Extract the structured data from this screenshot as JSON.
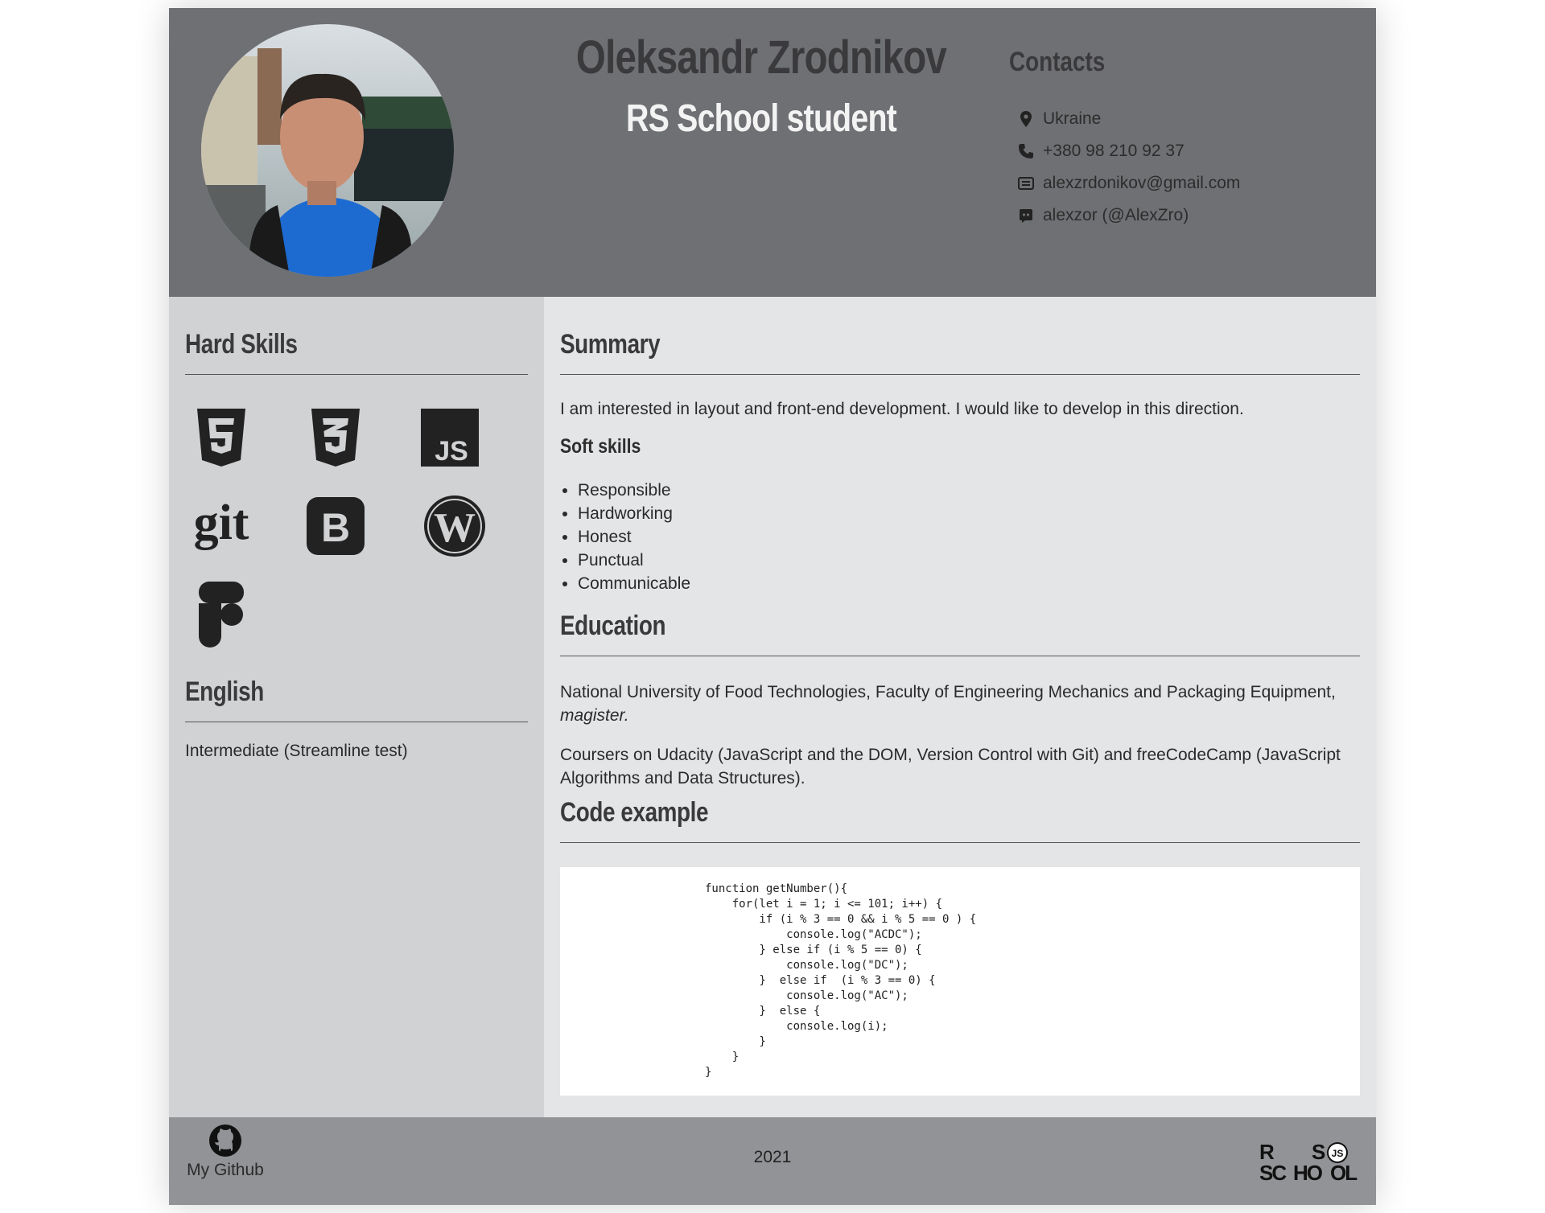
{
  "header": {
    "name": "Oleksandr Zrodnikov",
    "role": "RS School student",
    "contacts_title": "Contacts",
    "contacts": [
      {
        "icon": "location-pin-icon",
        "text": "Ukraine"
      },
      {
        "icon": "phone-icon",
        "text": "+380 98 210 92 37"
      },
      {
        "icon": "email-icon",
        "text": "alexzrdonikov@gmail.com"
      },
      {
        "icon": "discord-icon",
        "text": "alexzor (@AlexZro)"
      }
    ]
  },
  "sidebar": {
    "hard_skills_title": "Hard Skills",
    "skills": [
      "html5-icon",
      "css3-icon",
      "javascript-icon",
      "git-icon",
      "bootstrap-icon",
      "wordpress-icon",
      "figma-icon"
    ],
    "english_title": "English",
    "english_level": "Intermediate (Streamline test)"
  },
  "main": {
    "summary_title": "Summary",
    "summary_text": "I am interested in layout and front-end development. I would like to develop in this direction.",
    "soft_title": "Soft skills",
    "soft_skills": [
      "Responsible",
      "Hardworking",
      "Honest",
      "Punctual",
      "Communicable"
    ],
    "education_title": "Education",
    "education_1": "National University of Food Technologies, Faculty of Engineering Mechanics and Packaging Equipment,",
    "education_1_degree": "magister.",
    "education_2": "Coursers on Udacity (JavaScript and the DOM, Version Control with Git) and freeCodeCamp (JavaScript Algorithms and Data Structures).",
    "code_title": "Code example",
    "code": "function getNumber(){\n    for(let i = 1; i <= 101; i++) {\n        if (i % 3 == 0 && i % 5 == 0 ) {\n            console.log(\"ACDC\");\n        } else if (i % 5 == 0) {\n            console.log(\"DC\");\n        }  else if  (i % 3 == 0) {\n            console.log(\"AC\");\n        }  else {\n            console.log(i);\n        }\n    }\n}"
  },
  "footer": {
    "github_label": "My Github",
    "year": "2021",
    "logo_text": "RS SCHOOL JS"
  },
  "colors": {
    "header_bg": "#6f7073",
    "sidebar_bg": "#d1d2d4",
    "main_bg": "#e4e5e7",
    "footer_bg": "#929396"
  }
}
